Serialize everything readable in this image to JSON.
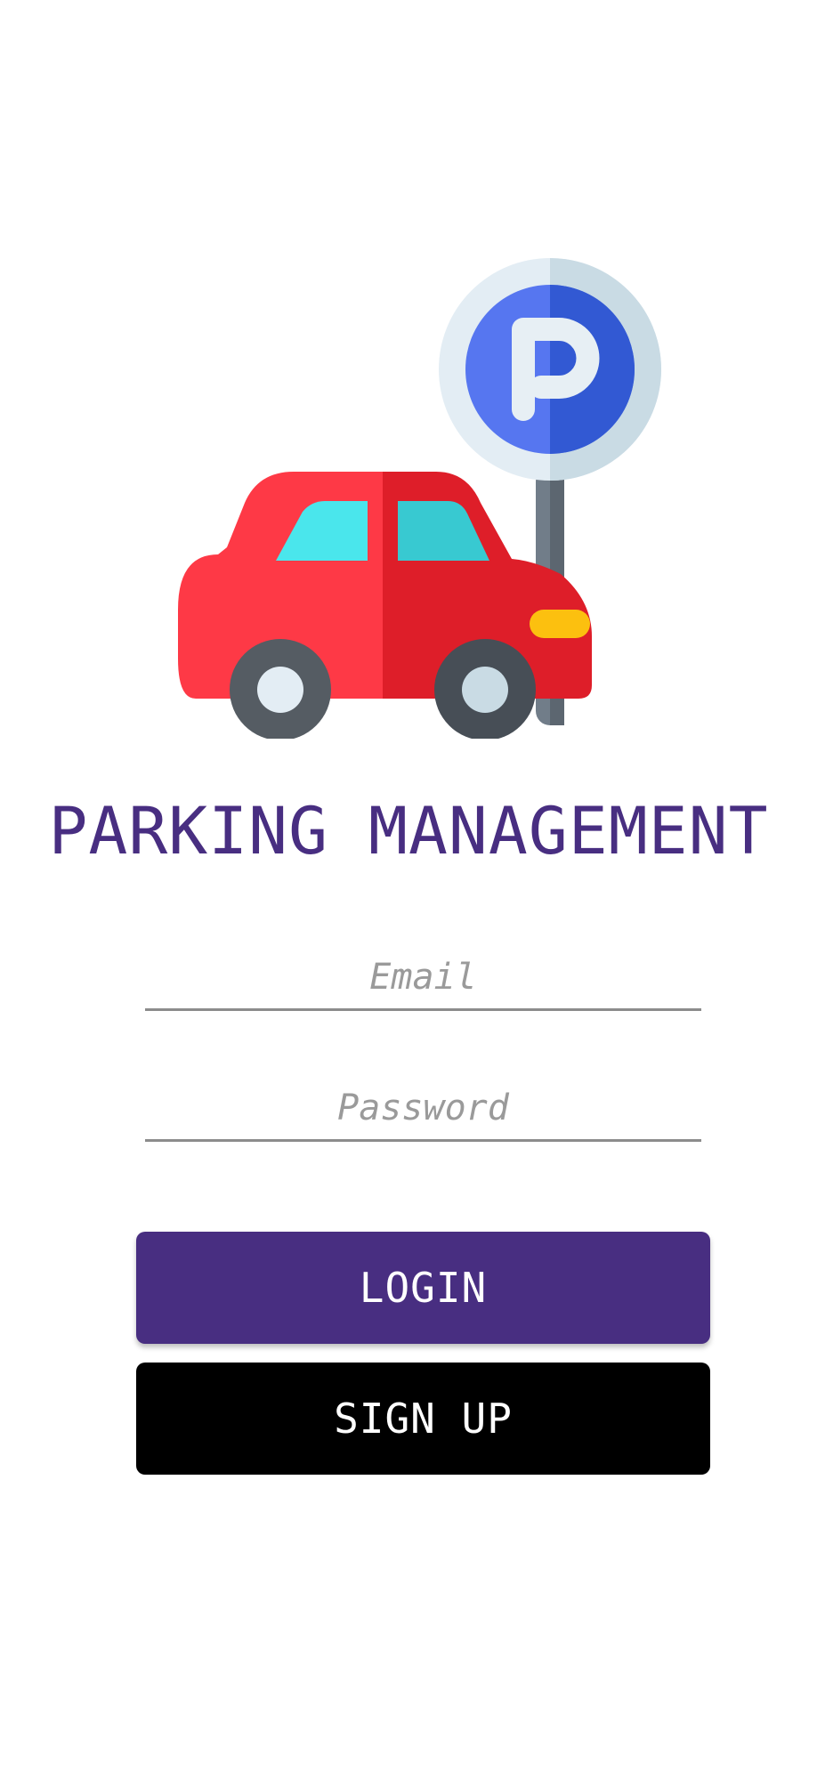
{
  "app": {
    "title": "PARKING MANAGEMENT"
  },
  "form": {
    "email_placeholder": "Email",
    "password_placeholder": "Password"
  },
  "buttons": {
    "login_label": "LOGIN",
    "signup_label": "SIGN UP"
  },
  "colors": {
    "brand": "#482e81",
    "signup_button": "#000000",
    "car_body": "#ff3d46",
    "parking_sign": "#4f70ee"
  },
  "icons": {
    "logo": "car-parking-icon"
  }
}
